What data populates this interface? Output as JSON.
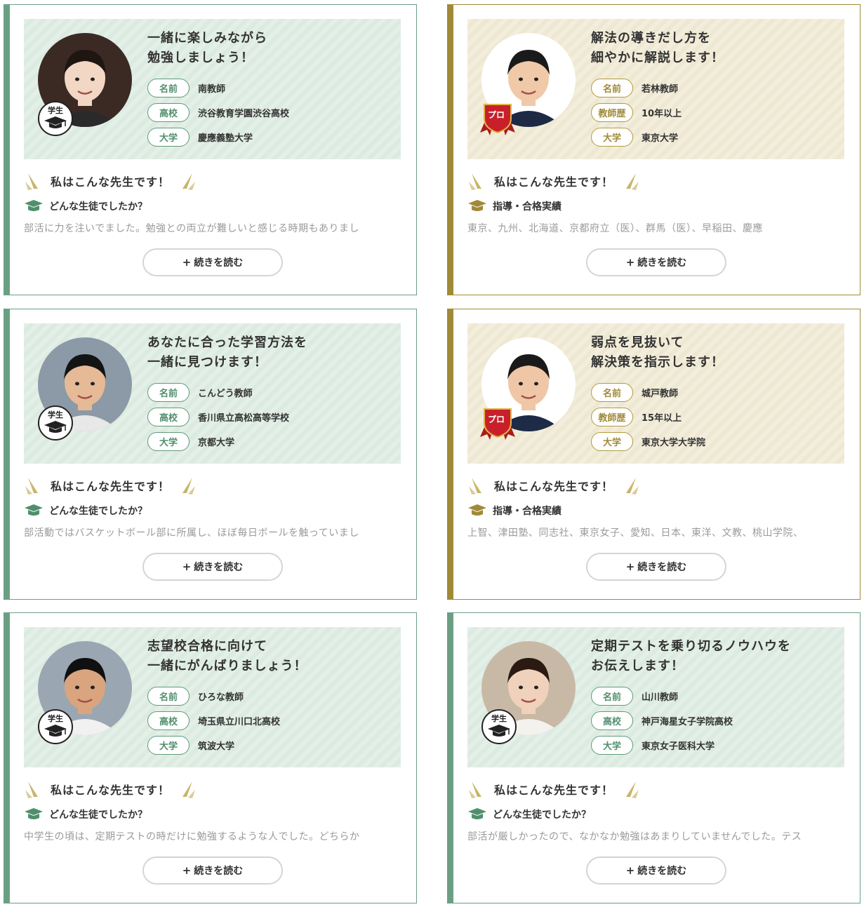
{
  "cards": [
    {
      "type": "student",
      "headline_1": "一緒に楽しみながら",
      "headline_2": "勉強しましょう！",
      "badge": "学生",
      "rows": [
        {
          "tag": "名前",
          "value": "南教師"
        },
        {
          "tag": "高校",
          "value": "渋谷教育学園渋谷高校"
        },
        {
          "tag": "大学",
          "value": "慶應義塾大学"
        }
      ],
      "intro": "私はこんな先生です！",
      "question": "どんな生徒でしたか？",
      "excerpt": "部活に力を注いでました。勉強との両立が難しいと感じる時期もありまし",
      "button": "続きを読む",
      "button_plus": "+",
      "hero_color": "#e3efe7",
      "avatar": {
        "bg": "#3b2a24",
        "skin": "#f2d7c5",
        "hair": "#1f1612",
        "cloth": "#2a2a2a"
      }
    },
    {
      "type": "pro",
      "headline_1": "解法の導きだし方を",
      "headline_2": "細やかに解説します！",
      "badge": "プロ",
      "rows": [
        {
          "tag": "名前",
          "value": "若林教師"
        },
        {
          "tag": "教師歴",
          "value": "10年以上"
        },
        {
          "tag": "大学",
          "value": "東京大学"
        }
      ],
      "intro": "私はこんな先生です！",
      "question": "指導・合格実績",
      "excerpt": "東京、九州、北海道、京都府立（医）、群馬（医）、早稲田、慶應",
      "button": "続きを読む",
      "button_plus": "+",
      "hero_color": "#f3eedc",
      "avatar": {
        "bg": "#ffffff",
        "skin": "#efc9a8",
        "hair": "#1a1a1a",
        "cloth": "#1e2a44"
      }
    },
    {
      "type": "student",
      "headline_1": "あなたに合った学習方法を",
      "headline_2": "一緒に見つけます！",
      "badge": "学生",
      "rows": [
        {
          "tag": "名前",
          "value": "こんどう教師"
        },
        {
          "tag": "高校",
          "value": "香川県立高松高等学校"
        },
        {
          "tag": "大学",
          "value": "京都大学"
        }
      ],
      "intro": "私はこんな先生です！",
      "question": "どんな生徒でしたか？",
      "excerpt": "部活動ではバスケットボール部に所属し、ほぼ毎日ボールを触っていまし",
      "button": "続きを読む",
      "button_plus": "+",
      "hero_color": "#e3efe7",
      "avatar": {
        "bg": "#8b9aa6",
        "skin": "#e6b997",
        "hair": "#141414",
        "cloth": "#e8e8e8"
      }
    },
    {
      "type": "pro",
      "headline_1": "弱点を見抜いて",
      "headline_2": "解決策を指示します！",
      "badge": "プロ",
      "rows": [
        {
          "tag": "名前",
          "value": "城戸教師"
        },
        {
          "tag": "教師歴",
          "value": "15年以上"
        },
        {
          "tag": "大学",
          "value": "東京大学大学院"
        }
      ],
      "intro": "私はこんな先生です！",
      "question": "指導・合格実績",
      "excerpt": "上智、津田塾、同志社、東京女子、愛知、日本、東洋、文教、桃山学院、",
      "button": "続きを読む",
      "button_plus": "+",
      "hero_color": "#f3eedc",
      "avatar": {
        "bg": "#ffffff",
        "skin": "#efc7a6",
        "hair": "#1a1a1a",
        "cloth": "#1d2b47"
      }
    },
    {
      "type": "student",
      "headline_1": "志望校合格に向けて",
      "headline_2": "一緒にがんばりましょう！",
      "badge": "学生",
      "rows": [
        {
          "tag": "名前",
          "value": "ひろな教師"
        },
        {
          "tag": "高校",
          "value": "埼玉県立川口北高校"
        },
        {
          "tag": "大学",
          "value": "筑波大学"
        }
      ],
      "intro": "私はこんな先生です！",
      "question": "どんな生徒でしたか？",
      "excerpt": "中学生の頃は、定期テストの時だけに勉強するような人でした。どちらか",
      "button": "続きを読む",
      "button_plus": "+",
      "hero_color": "#e3efe7",
      "avatar": {
        "bg": "#9aa7b2",
        "skin": "#d9a47e",
        "hair": "#101010",
        "cloth": "#f1f1f1"
      }
    },
    {
      "type": "student",
      "headline_1": "定期テストを乗り切るノウハウを",
      "headline_2": "お伝えします！",
      "badge": "学生",
      "rows": [
        {
          "tag": "名前",
          "value": "山川教師"
        },
        {
          "tag": "高校",
          "value": "神戸海星女子学院高校"
        },
        {
          "tag": "大学",
          "value": "東京女子医科大学"
        }
      ],
      "intro": "私はこんな先生です！",
      "question": "どんな生徒でしたか？",
      "excerpt": "部活が厳しかったので、なかなか勉強はあまりしていませんでした。テス",
      "button": "続きを読む",
      "button_plus": "+",
      "hero_color": "#e3efe7",
      "avatar": {
        "bg": "#c8b9a6",
        "skin": "#f0d1bb",
        "hair": "#2a1a12",
        "cloth": "#f4f2ee"
      }
    }
  ]
}
